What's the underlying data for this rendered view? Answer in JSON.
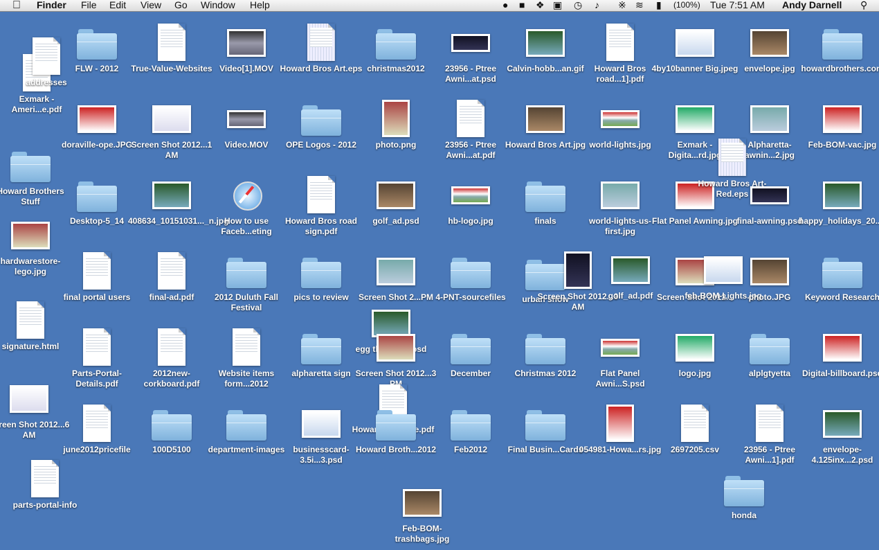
{
  "menubar": {
    "app_name": "Finder",
    "menus": [
      "File",
      "Edit",
      "View",
      "Go",
      "Window",
      "Help"
    ],
    "status_icons": [
      "evernote-icon",
      "contacts-icon",
      "dropbox-icon",
      "display-icon",
      "time-machine-icon",
      "volume-icon",
      "bluetooth-icon",
      "wifi-icon",
      "battery-icon"
    ],
    "battery": "(100%)",
    "clock": "Tue 7:51 AM",
    "user": "Andy Darnell"
  },
  "colors": {
    "desktop": "#4a78b8",
    "folder": "#9cc8ec"
  },
  "desktop_items": [
    {
      "label": "FLW - 2012",
      "kind": "folder"
    },
    {
      "label": "True-Value-Websites",
      "kind": "xlsx"
    },
    {
      "label": "Video[1].MOV",
      "kind": "video"
    },
    {
      "label": "Howard Bros Art.eps",
      "kind": "eps"
    },
    {
      "label": "christmas2012",
      "kind": "folder"
    },
    {
      "label": "23956 - Ptree Awni...at.psd",
      "kind": "image"
    },
    {
      "label": "Calvin-hobb...an.gif",
      "kind": "image"
    },
    {
      "label": "Howard Bros road...1].pdf",
      "kind": "pdf"
    },
    {
      "label": "4by10banner Big.jpeg",
      "kind": "image"
    },
    {
      "label": "envelope.jpg",
      "kind": "image"
    },
    {
      "label": "howardbrothers.com",
      "kind": "folder"
    },
    {
      "label": "Exmark - Ameri...e.pdf",
      "kind": "pdf"
    },
    {
      "label": "addresses",
      "kind": "xlsx"
    },
    {
      "label": "doraville-ope.JPG",
      "kind": "image"
    },
    {
      "label": "Screen Shot 2012...1 AM",
      "kind": "image"
    },
    {
      "label": "Video.MOV",
      "kind": "video"
    },
    {
      "label": "OPE Logos - 2012",
      "kind": "folder"
    },
    {
      "label": "photo.png",
      "kind": "image"
    },
    {
      "label": "23956 - Ptree Awni...at.pdf",
      "kind": "pdf"
    },
    {
      "label": "Howard Bros Art.jpg",
      "kind": "image"
    },
    {
      "label": "world-lights.jpg",
      "kind": "image"
    },
    {
      "label": "Exmark - Digita...rd.jpg",
      "kind": "image"
    },
    {
      "label": "Alpharetta-awnin...2.jpg",
      "kind": "image"
    },
    {
      "label": "Feb-BOM-vac.jpg",
      "kind": "image"
    },
    {
      "label": "Howard Brothers Stuff",
      "kind": "folder"
    },
    {
      "label": "Desktop-5_14",
      "kind": "folder"
    },
    {
      "label": "408634_10151031..._n.jpg",
      "kind": "image"
    },
    {
      "label": "How to use Faceb...eting",
      "kind": "app"
    },
    {
      "label": "Howard Bros road sign.pdf",
      "kind": "pdf"
    },
    {
      "label": "golf_ad.psd",
      "kind": "image"
    },
    {
      "label": "hb-logo.jpg",
      "kind": "image"
    },
    {
      "label": "finals",
      "kind": "folder"
    },
    {
      "label": "world-lights-us-first.jpg",
      "kind": "image"
    },
    {
      "label": "Flat Panel Awning.jpg",
      "kind": "image"
    },
    {
      "label": "Howard Bros Art-Red.eps",
      "kind": "eps"
    },
    {
      "label": "final-awning.psd",
      "kind": "image"
    },
    {
      "label": "happy_holidays_20...er.jpg",
      "kind": "image"
    },
    {
      "label": "hardwarestore-lego.jpg",
      "kind": "image"
    },
    {
      "label": "final portal users",
      "kind": "xlsx"
    },
    {
      "label": "final-ad.pdf",
      "kind": "pdf"
    },
    {
      "label": "2012 Duluth Fall Festival",
      "kind": "folder"
    },
    {
      "label": "pics to review",
      "kind": "folder"
    },
    {
      "label": "Screen Shot 2...PM",
      "kind": "image"
    },
    {
      "label": "4-PNT-sourcefiles",
      "kind": "folder"
    },
    {
      "label": "urban show",
      "kind": "folder"
    },
    {
      "label": "Screen Shot 2012...3 AM",
      "kind": "image"
    },
    {
      "label": "golf_ad.pdf",
      "kind": "image"
    },
    {
      "label": "Screen Shot 2012...",
      "kind": "image"
    },
    {
      "label": "feb-BOM-Lights.jpg",
      "kind": "image"
    },
    {
      "label": "photo.JPG",
      "kind": "image"
    },
    {
      "label": "Keyword Research",
      "kind": "folder"
    },
    {
      "label": "signature.html",
      "kind": "html"
    },
    {
      "label": "Parts-Portal-Details.pdf",
      "kind": "pdf"
    },
    {
      "label": "2012new-corkboard.pdf",
      "kind": "pdf"
    },
    {
      "label": "Website items form...2012",
      "kind": "docx"
    },
    {
      "label": "alpharetta sign",
      "kind": "folder"
    },
    {
      "label": "egg thankyou.psd",
      "kind": "image"
    },
    {
      "label": "Screen Shot 2012...3 PM",
      "kind": "image"
    },
    {
      "label": "December",
      "kind": "folder"
    },
    {
      "label": "Christmas 2012",
      "kind": "folder"
    },
    {
      "label": "Flat Panel Awni...S.psd",
      "kind": "image"
    },
    {
      "label": "logo.jpg",
      "kind": "image"
    },
    {
      "label": "alplgtyetta",
      "kind": "folder"
    },
    {
      "label": "Digital-billboard.psd",
      "kind": "image"
    },
    {
      "label": "Screen Shot 2012...6 AM",
      "kind": "image"
    },
    {
      "label": "june2012pricefile",
      "kind": "xls"
    },
    {
      "label": "100D5100",
      "kind": "folder"
    },
    {
      "label": "department-images",
      "kind": "folder"
    },
    {
      "label": "businesscard-3.5i...3.psd",
      "kind": "image"
    },
    {
      "label": "Howard-Broth...e.pdf",
      "kind": "pdf"
    },
    {
      "label": "Howard Broth...2012",
      "kind": "folder"
    },
    {
      "label": "Feb2012",
      "kind": "folder"
    },
    {
      "label": "Final Busin...Cards",
      "kind": "folder"
    },
    {
      "label": "054981-Howa...rs.jpg",
      "kind": "image"
    },
    {
      "label": "2697205.csv",
      "kind": "csv"
    },
    {
      "label": "23956 - Ptree Awni...1].pdf",
      "kind": "pdf"
    },
    {
      "label": "envelope-4.125inx...2.psd",
      "kind": "image"
    },
    {
      "label": "parts-portal-info",
      "kind": "xlsx"
    },
    {
      "label": "honda",
      "kind": "folder"
    },
    {
      "label": "Feb-BOM-trashbags.jpg",
      "kind": "image"
    }
  ]
}
